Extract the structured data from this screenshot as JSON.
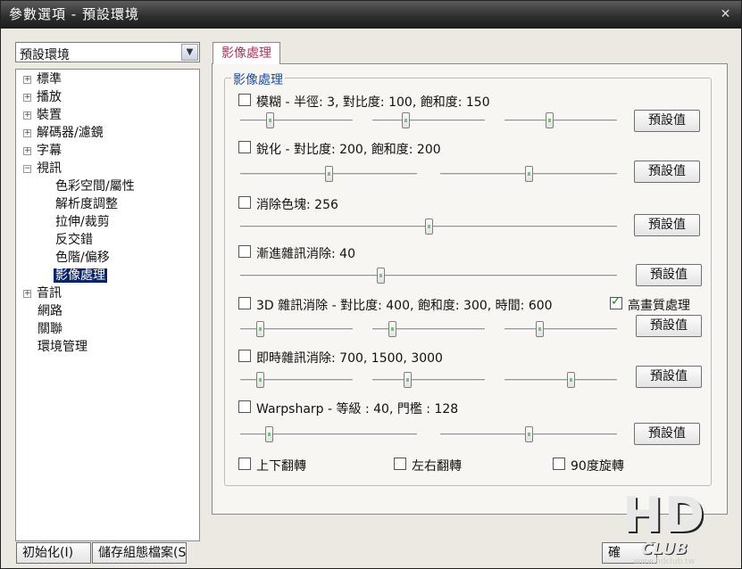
{
  "window": {
    "title": "參數選項 - 預設環境",
    "close_glyph": "✕"
  },
  "profile_combo": {
    "value": "預設環境",
    "arrow": "▼"
  },
  "tree": {
    "items": [
      {
        "label": "標準",
        "exp": "+"
      },
      {
        "label": "播放",
        "exp": "+"
      },
      {
        "label": "裝置",
        "exp": "+"
      },
      {
        "label": "解碼器/濾鏡",
        "exp": "+"
      },
      {
        "label": "字幕",
        "exp": "+"
      },
      {
        "label": "視訊",
        "exp": "−"
      },
      {
        "label": "色彩空間/屬性"
      },
      {
        "label": "解析度調整"
      },
      {
        "label": "拉伸/裁剪"
      },
      {
        "label": "反交錯"
      },
      {
        "label": "色階/偏移"
      },
      {
        "label": "影像處理"
      },
      {
        "label": "音訊",
        "exp": "+"
      },
      {
        "label": "網路"
      },
      {
        "label": "關聯"
      },
      {
        "label": "環境管理"
      }
    ]
  },
  "tab": {
    "label": "影像處理"
  },
  "group": {
    "title": "影像處理"
  },
  "settings": {
    "blur": {
      "label": "模糊 - 半徑: 3, 對比度: 100, 飽和度: 150",
      "checked": false,
      "levels": [
        0.25,
        0.28,
        0.39
      ],
      "default_label": "預設值"
    },
    "sharpen": {
      "label": "銳化 - 對比度: 200, 飽和度: 200",
      "checked": false,
      "levels": [
        0.5,
        0.5
      ],
      "default_label": "預設值"
    },
    "deblock": {
      "label": "消除色塊: 256",
      "checked": false,
      "levels": [
        0.5
      ],
      "default_label": "預設值"
    },
    "temporal_denoise": {
      "label": "漸進雜訊消除: 40",
      "checked": false,
      "levels": [
        0.37
      ],
      "default_label": "預設值"
    },
    "denoise3d": {
      "label": "3D 雜訊消除 - 對比度: 400, 飽和度: 300, 時間: 600",
      "checked": false,
      "hq_label": "高畫質處理",
      "hq_checked": true,
      "levels": [
        0.15,
        0.15,
        0.3
      ],
      "default_label": "預設值"
    },
    "realtime_denoise": {
      "label": "即時雜訊消除: 700, 1500, 3000",
      "checked": false,
      "levels": [
        0.15,
        0.3,
        0.6
      ],
      "default_label": "預設值"
    },
    "warpsharp": {
      "label": "Warpsharp - 等級 : 40, 門檻 : 128",
      "checked": false,
      "levels": [
        0.15,
        0.5
      ],
      "default_label": "預設值"
    },
    "flip_vertical": {
      "label": "上下翻轉",
      "checked": false
    },
    "flip_horizontal": {
      "label": "左右翻轉",
      "checked": false
    },
    "rotate90": {
      "label": "90度旋轉",
      "checked": false
    }
  },
  "buttons": {
    "reset": "初始化(I)",
    "save_profile": "儲存組態檔案(S",
    "ok_partial": "確"
  },
  "watermark": {
    "hd": "HD",
    "club": "CLUB",
    "site": "www.hdclub.tw"
  }
}
